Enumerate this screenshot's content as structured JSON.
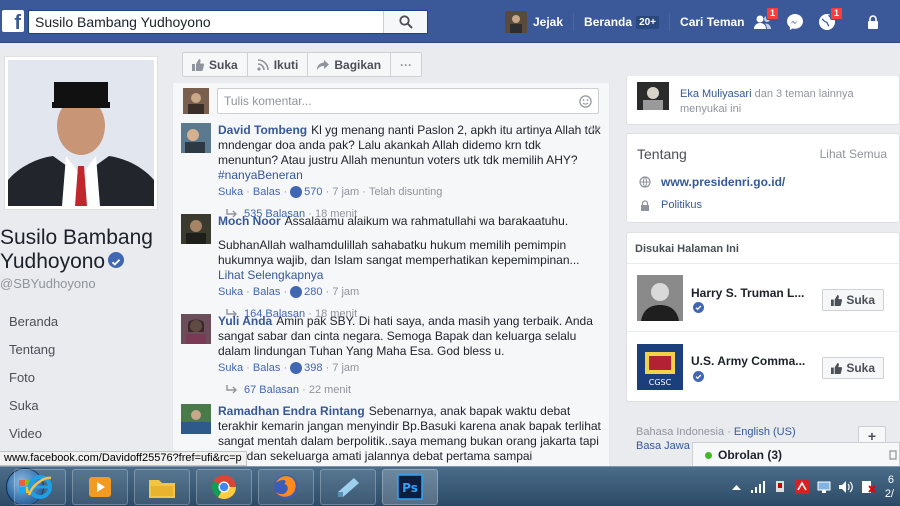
{
  "topbar": {
    "search_value": "Susilo Bambang Yudhoyono",
    "nav_user": "Jejak",
    "nav_home": "Beranda",
    "nav_home_badge": "20+",
    "nav_find_friends": "Cari Teman",
    "friend_requests_badge": "1",
    "notifications_badge": "1",
    "brand_color": "#3b5998"
  },
  "page": {
    "name_line1": "Susilo Bambang",
    "name_line2": "Yudhoyono",
    "handle": "@SBYudhoyono",
    "nav": [
      "Beranda",
      "Tentang",
      "Foto",
      "Suka",
      "Video"
    ]
  },
  "actions": {
    "like": "Suka",
    "follow": "Ikuti",
    "share": "Bagikan",
    "more": "···"
  },
  "comments": {
    "write_placeholder": "Tulis komentar...",
    "items": [
      {
        "name": "David Tombeng",
        "text": "Kl yg menang nanti Paslon 2, apkh itu artinya Allah tdk mndengar doa anda pak? Lalu akankah Allah didemo krn tdk menuntun? Atau justru Allah menuntun voters utk tdk memilih AHY?",
        "hashtag": "#nanyaBeneran",
        "like": "Suka",
        "reply": "Balas",
        "likes": "570",
        "time": "7 jam",
        "edited": "Telah disunting",
        "replies": "535 Balasan",
        "replies_time": "18 menit"
      },
      {
        "name": "Moch Noor",
        "text_p1": "Assalaamu alaikum wa rahmatullahi wa barakaatuhu.",
        "text_p2": "SubhanAllah walhamdulillah sahabatku hukum memilih pemimpin hukumnya wajib, dan Islam sangat memperhatikan kepemimpinan...",
        "see_more": "Lihat Selengkapnya",
        "like": "Suka",
        "reply": "Balas",
        "likes": "280",
        "time": "7 jam",
        "replies": "164 Balasan",
        "replies_time": "18 menit"
      },
      {
        "name": "Yuli Anda",
        "text": "Amin pak SBY. Di hati saya, anda masih yang terbaik. Anda sangat sabar dan cinta negara. Semoga Bapak dan keluarga selalu dalam lindungan Tuhan Yang Maha Esa. God bless u.",
        "like": "Suka",
        "reply": "Balas",
        "likes": "398",
        "time": "7 jam",
        "replies": "67 Balasan",
        "replies_time": "22 menit"
      },
      {
        "name": "Ramadhan Endra Rintang",
        "text": "Sebenarnya, anak bapak waktu debat terakhir kemarin jangan menyindir Bp.Basuki karena anak bapak terlihat sangat mentah dalam berpolitik..saya memang bukan orang jakarta tapi saya dan sekeluarga",
        "text_tail": "amati jalannya debat pertama sampai"
      }
    ]
  },
  "right": {
    "likers_name": "Eka Muliyasari",
    "likers_rest": "dan 3 teman lainnya",
    "likers_suffix": "menyukai ini",
    "about_title": "Tentang",
    "about_see_all": "Lihat Semua",
    "website": "www.presidenri.go.id/",
    "category": "Politikus",
    "liked_title": "Disukai Halaman Ini",
    "liked_pages": [
      {
        "name": "Harry S. Truman L...",
        "button": "Suka"
      },
      {
        "name": "U.S. Army Comma...",
        "button": "Suka"
      }
    ],
    "lang_current": "Bahasa Indonesia",
    "lang_sep": "·",
    "lang_english": "English (US)",
    "lang_javanese": "Basa Jawa",
    "lang_add": "+"
  },
  "status_url": "www.facebook.com/Davidoff25576?fref=ufi&rc=p",
  "chat": {
    "label": "Obrolan (3)"
  },
  "tray": {
    "clock_line1": "6",
    "clock_line2": "2/"
  }
}
